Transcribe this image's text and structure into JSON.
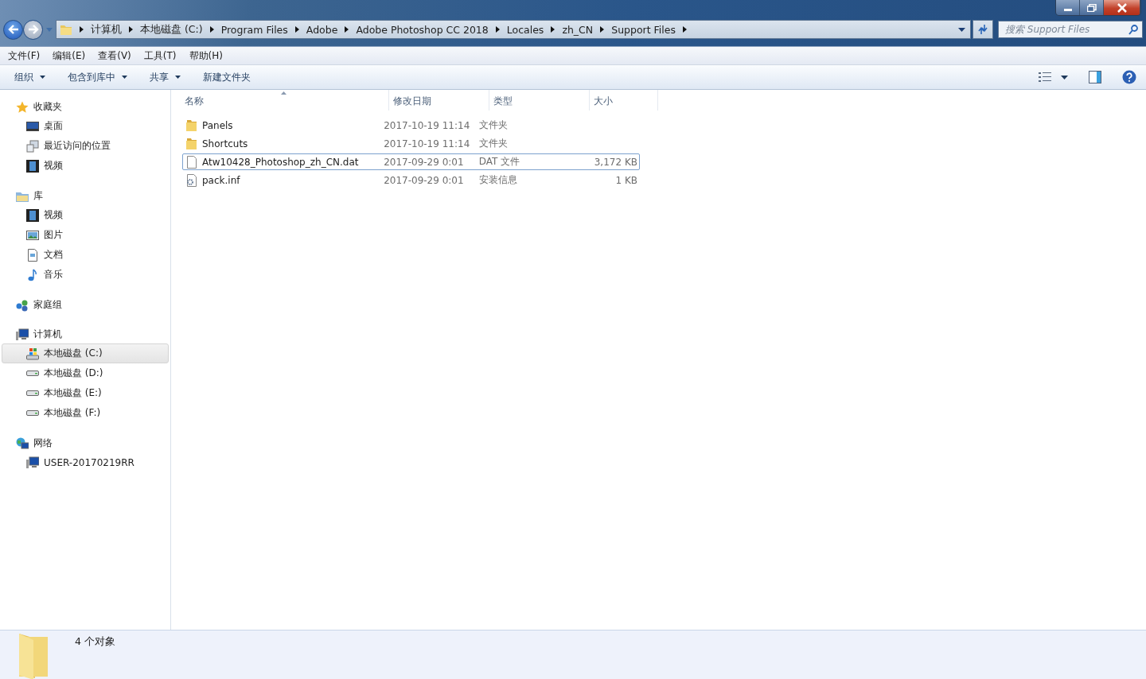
{
  "breadcrumb": [
    "计算机",
    "本地磁盘 (C:)",
    "Program Files",
    "Adobe",
    "Adobe Photoshop CC 2018",
    "Locales",
    "zh_CN",
    "Support Files"
  ],
  "search": {
    "placeholder": "搜索 Support Files"
  },
  "menu": [
    "文件(F)",
    "编辑(E)",
    "查看(V)",
    "工具(T)",
    "帮助(H)"
  ],
  "toolbar": [
    {
      "label": "组织",
      "dropdown": true
    },
    {
      "label": "包含到库中",
      "dropdown": true
    },
    {
      "label": "共享",
      "dropdown": true
    },
    {
      "label": "新建文件夹",
      "dropdown": false
    }
  ],
  "sidebar": [
    {
      "label": "收藏夹",
      "kind": "star",
      "children": [
        {
          "label": "桌面",
          "kind": "desktop",
          "selected": false
        },
        {
          "label": "最近访问的位置",
          "kind": "recent",
          "selected": false
        },
        {
          "label": "视频",
          "kind": "video",
          "selected": false
        }
      ]
    },
    {
      "label": "库",
      "kind": "library",
      "children": [
        {
          "label": "视频",
          "kind": "video",
          "selected": false
        },
        {
          "label": "图片",
          "kind": "picture",
          "selected": false
        },
        {
          "label": "文档",
          "kind": "document",
          "selected": false
        },
        {
          "label": "音乐",
          "kind": "music",
          "selected": false
        }
      ]
    },
    {
      "label": "家庭组",
      "kind": "homegroup"
    },
    {
      "label": "计算机",
      "kind": "computer",
      "children": [
        {
          "label": "本地磁盘 (C:)",
          "kind": "sysdrive",
          "selected": true
        },
        {
          "label": "本地磁盘 (D:)",
          "kind": "drive",
          "selected": false
        },
        {
          "label": "本地磁盘 (E:)",
          "kind": "drive",
          "selected": false
        },
        {
          "label": "本地磁盘 (F:)",
          "kind": "drive",
          "selected": false
        }
      ]
    },
    {
      "label": "网络",
      "kind": "network",
      "children": [
        {
          "label": "USER-20170219RR",
          "kind": "computer",
          "selected": false
        }
      ]
    }
  ],
  "table": {
    "columns": [
      "名称",
      "修改日期",
      "类型",
      "大小"
    ],
    "rows": [
      {
        "name": "Panels",
        "modified": "2017-10-19 11:14",
        "type": "文件夹",
        "kind": "folder",
        "selected": false
      },
      {
        "name": "Shortcuts",
        "modified": "2017-10-19 11:14",
        "type": "文件夹",
        "kind": "folder",
        "selected": false
      },
      {
        "name": "Atw10428_Photoshop_zh_CN.dat",
        "modified": "2017-09-29 0:01",
        "type": "DAT 文件",
        "size": "3,172 KB",
        "kind": "file",
        "selected": true
      },
      {
        "name": "pack.inf",
        "modified": "2017-09-29 0:01",
        "type": "安装信息",
        "size": "1 KB",
        "kind": "setup",
        "selected": false
      }
    ]
  },
  "status_bar": {
    "count": "4 个对象"
  }
}
